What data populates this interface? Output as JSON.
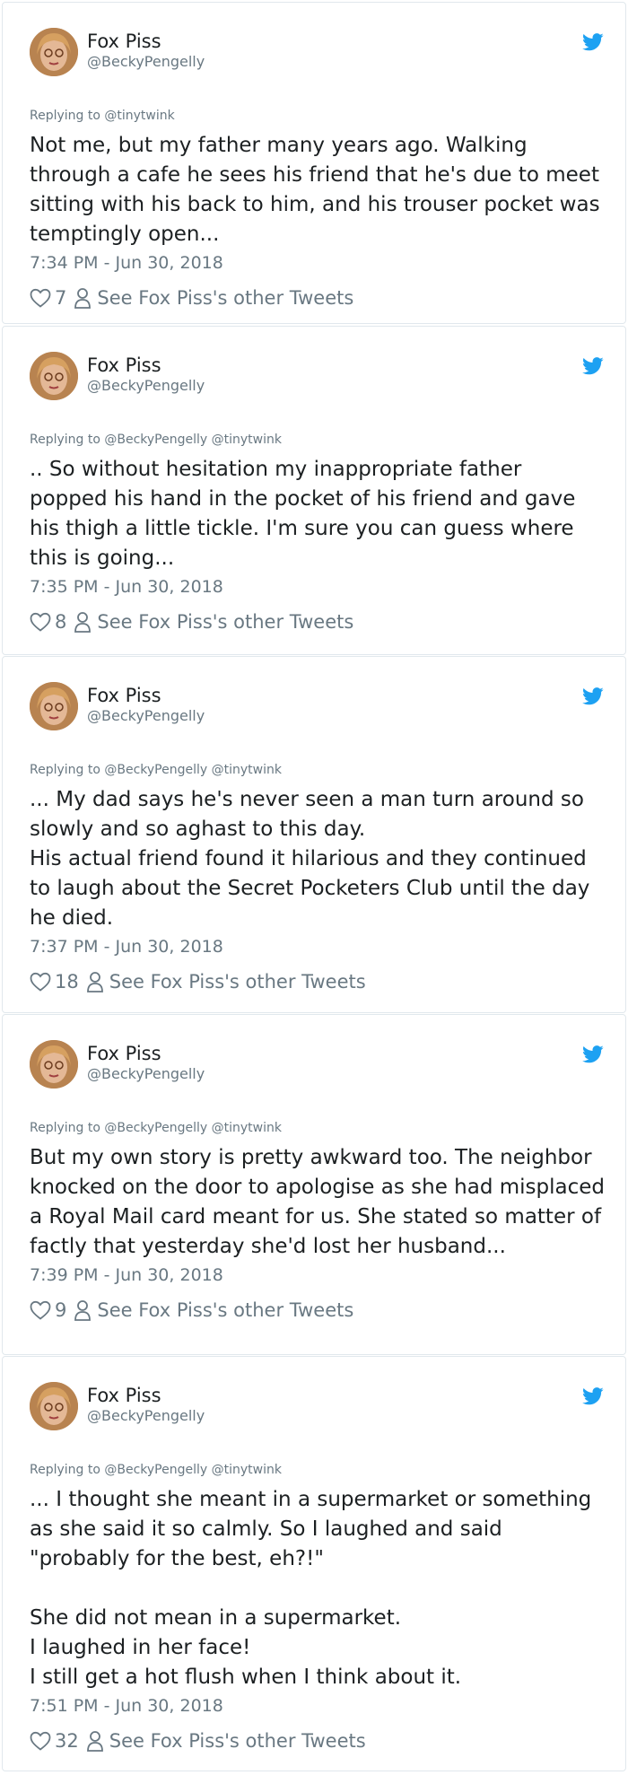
{
  "author": {
    "name": "Fox Piss",
    "handle": "@BeckyPengelly"
  },
  "icons": {
    "brand": "twitter-bird-icon",
    "like": "heart-icon",
    "profile": "person-icon"
  },
  "colors": {
    "twitter_blue": "#1da1f2",
    "muted": "#697882",
    "text": "#1c2022",
    "border": "#e1e8ed"
  },
  "tweets": [
    {
      "replying": "Replying to @tinytwink",
      "text": "Not me, but my father many years ago. Walking through a cafe he sees his friend that he's due to meet sitting with his back to him, and his trouser pocket was temptingly open...",
      "time": "7:34 PM - Jun 30, 2018",
      "likes": "7",
      "other": "See Fox Piss's other Tweets"
    },
    {
      "replying": "Replying to @BeckyPengelly @tinytwink",
      "text": ".. So without hesitation my inappropriate father popped his hand in the pocket of his friend and gave his thigh a little tickle. I'm sure you can guess where this is going...",
      "time": "7:35 PM - Jun 30, 2018",
      "likes": "8",
      "other": "See Fox Piss's other Tweets"
    },
    {
      "replying": "Replying to @BeckyPengelly @tinytwink",
      "text": "... My dad says he's never seen a man turn around so slowly and so aghast to this day.\nHis actual friend found it hilarious and they continued to laugh about the Secret Pocketers Club until the day he died.",
      "time": "7:37 PM - Jun 30, 2018",
      "likes": "18",
      "other": "See Fox Piss's other Tweets"
    },
    {
      "replying": "Replying to @BeckyPengelly @tinytwink",
      "text": "But my own story is pretty awkward too. The neighbor knocked on the door to apologise as she had misplaced a Royal Mail card meant for us. She stated so matter of factly that yesterday she'd lost her husband...",
      "time": "7:39 PM - Jun 30, 2018",
      "likes": "9",
      "other": "See Fox Piss's other Tweets"
    },
    {
      "replying": "Replying to @BeckyPengelly @tinytwink",
      "text": "... I thought she meant in a supermarket or something as she said it so calmly. So I laughed and said \"probably for the best, eh?!\"\n\nShe did not mean in a supermarket.\nI laughed in her face!\nI still get a hot flush when I think about it.",
      "time": "7:51 PM - Jun 30, 2018",
      "likes": "32",
      "other": "See Fox Piss's other Tweets"
    }
  ]
}
